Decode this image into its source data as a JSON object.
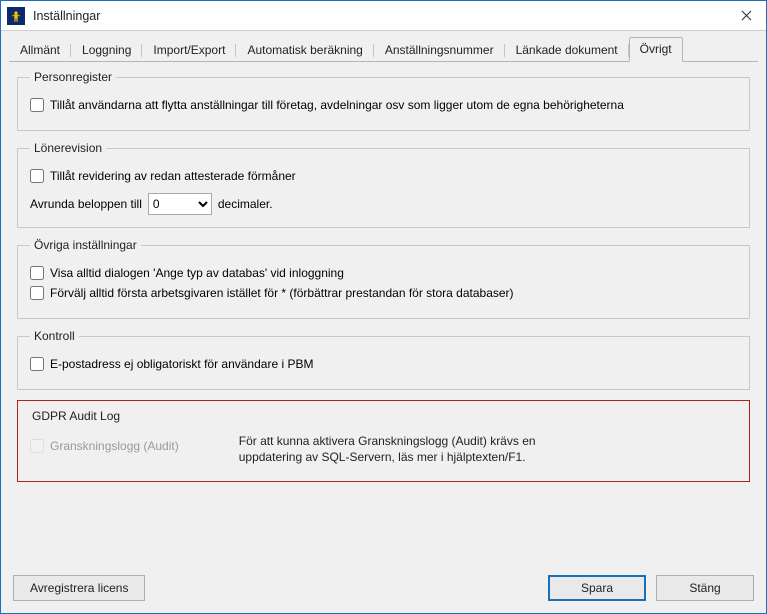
{
  "window": {
    "title": "Inställningar"
  },
  "tabs": [
    {
      "label": "Allmänt"
    },
    {
      "label": "Loggning"
    },
    {
      "label": "Import/Export"
    },
    {
      "label": "Automatisk beräkning"
    },
    {
      "label": "Anställningsnummer"
    },
    {
      "label": "Länkade dokument"
    },
    {
      "label": "Övrigt"
    }
  ],
  "groups": {
    "personregister": {
      "legend": "Personregister",
      "allow_move_employments": "Tillåt användarna att flytta anställningar till företag, avdelningar osv som ligger utom de egna behörigheterna"
    },
    "lonerevision": {
      "legend": "Lönerevision",
      "allow_revise_attested": "Tillåt revidering av redan attesterade förmåner",
      "round_prefix": "Avrunda beloppen till",
      "round_value": "0",
      "round_suffix": "decimaler."
    },
    "ovriga": {
      "legend": "Övriga inställningar",
      "always_show_db_dialog": "Visa alltid dialogen 'Ange typ av databas' vid inloggning",
      "preselect_first_employer": "Förvälj alltid första arbetsgivaren istället för * (förbättrar prestandan för stora databaser)"
    },
    "kontroll": {
      "legend": "Kontroll",
      "email_optional": "E-postadress ej obligatoriskt för användare i PBM"
    },
    "gdpr": {
      "legend": "GDPR Audit Log",
      "audit_label": "Granskningslogg (Audit)",
      "note": "För att kunna aktivera Granskningslogg (Audit) krävs en uppdatering av SQL-Servern, läs mer i hjälptexten/F1."
    }
  },
  "buttons": {
    "deregister": "Avregistrera licens",
    "save": "Spara",
    "close": "Stäng"
  }
}
